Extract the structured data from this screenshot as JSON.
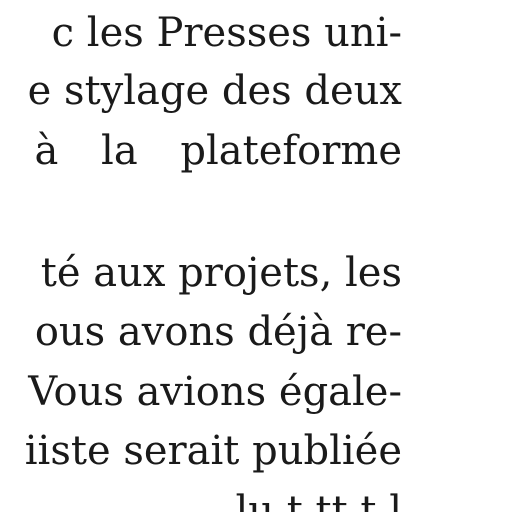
{
  "paragraphs": [
    {
      "lines": [
        "c les Presses uni-",
        "e stylage des deux",
        "à la plateforme"
      ]
    },
    {
      "lines": [
        "té aux projets, les",
        "ous avons déjà re-",
        "Vous avions égale-",
        "iiste serait publiée",
        "lu   t   tt   t   l"
      ]
    }
  ]
}
